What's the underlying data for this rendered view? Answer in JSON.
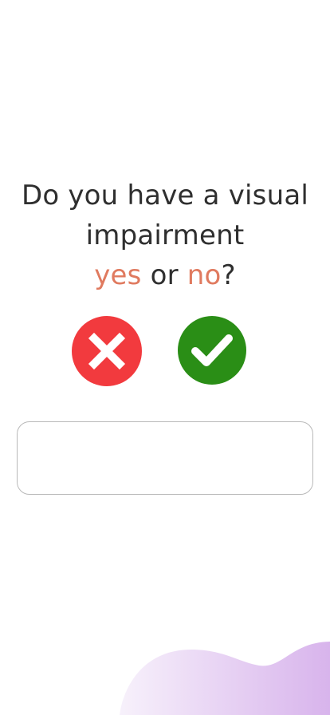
{
  "question": {
    "line1": "Do you have a visual",
    "line2": "impairment",
    "yes_word": "yes",
    "or_word": " or ",
    "no_word": "no",
    "question_mark": "?"
  },
  "buttons": {
    "no_icon": "close-icon",
    "yes_icon": "check-icon"
  },
  "answer_box": {
    "value": ""
  },
  "colors": {
    "accent": "#e07a5f",
    "no_button": "#f23a3e",
    "yes_button": "#2a8e16",
    "blob_start": "#f5eefb",
    "blob_end": "#d8b4ec"
  }
}
